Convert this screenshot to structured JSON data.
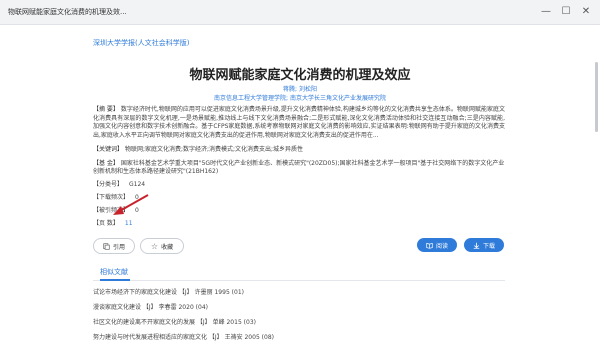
{
  "window": {
    "title": "物联网赋能家庭文化消费的机理及效...",
    "controls": {
      "minimize": "—",
      "maximize": "☐",
      "close": "✕"
    }
  },
  "article": {
    "journal": "深圳大学学报(人文社会科学版)",
    "title": "物联网赋能家庭文化消费的机理及效应",
    "authors": "蒋腾; 刘松阳",
    "orgs": "南京信息工程大学管理学院; 南京大学长三角文化产业发展研究院",
    "abstract_label": "【摘 要】",
    "abstract_text": "数字经济时代,物联网的应用可以促进家庭文化消费场景升级,提升文化消费精神体验,构建城乡均等化的文化消费共享生态体系。物联网赋能家庭文化消费具有深层的数字文化机理,一是场景赋能,推动线上与线下文化消费场景融合;二是形式赋能,深化文化消费活动体验和社交连接互动融合;三是内容赋能,加强文化内容创意和数字技术创新融合。基于CFPS家庭数据,系统考察物联网对家庭文化消费的影响效应,实证结果表明:物联网有助于提升家庭的文化消费支出,家庭收入水平正向调节物联网对家庭文化消费支出的促进作用,物联网对家庭文化消费支出的促进作用在...",
    "keywords_label": "【关键词】",
    "keywords_text": "物联网;家庭文化消费;数字经济;消费模式;文化消费支出;城乡异质性",
    "fund_label": "【基 金】",
    "fund_text": "国家社科基金艺术学重大项目\"5G时代文化产业创新业态、新模式研究\"(20ZD05);国家社科基金艺术学一般项目\"基于社交网络下的数字文化产业创新机制和生态体系路径建设研究\"(21BH162)",
    "classno_label": "【分类号】",
    "classno": "G124",
    "downloads_label": "【下载频次】",
    "downloads": "0",
    "cited_label": "【被引频次】",
    "cited": "0",
    "pages_label": "【页 数】",
    "pages": "11"
  },
  "actions": {
    "cite": "引用",
    "favorite": "收藏",
    "read": "阅读",
    "download": "下载"
  },
  "related": {
    "section_title": "相似文献",
    "items": [
      "试论市场经济下的家庭文化建设 【J】 许墨丽 1995 (01)",
      "漫谈家庭文化建设 【J】 李春雷 2020 (04)",
      "社区文化的建设离不开家庭文化的发展 【J】 单峰 2015 (03)",
      "努力建设与时代发展进程相适应的家庭文化 【J】 王祷安 2005 (08)"
    ]
  },
  "colors": {
    "accent": "#2f7bd9",
    "annotation_arrow": "#c8232c"
  }
}
